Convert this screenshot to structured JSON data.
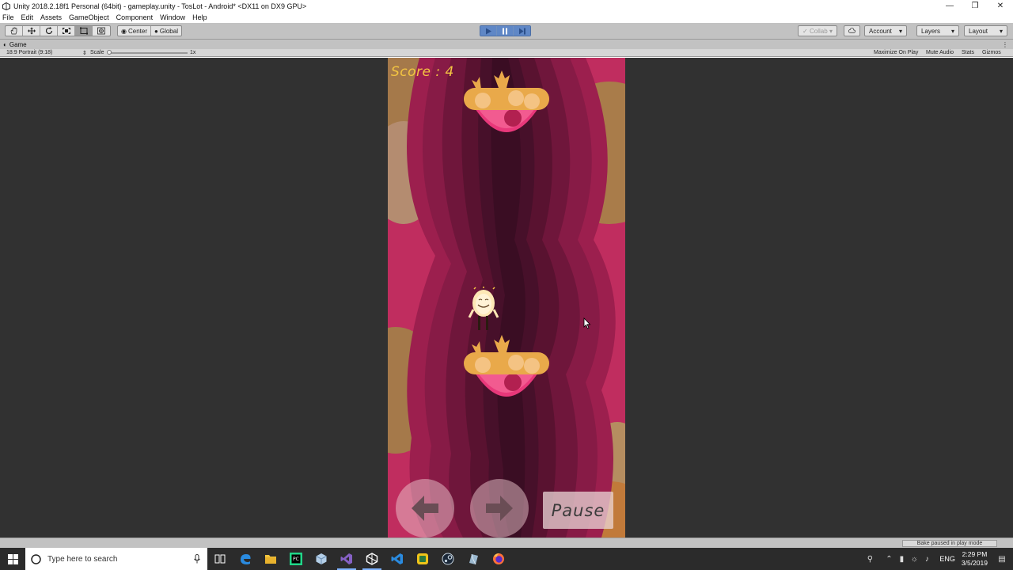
{
  "window": {
    "title": "Unity 2018.2.18f1 Personal (64bit) - gameplay.unity - TosLot - Android* <DX11 on DX9 GPU>",
    "controls": [
      "minimize-icon",
      "restore-icon",
      "close-icon"
    ]
  },
  "menu": [
    "File",
    "Edit",
    "Assets",
    "GameObject",
    "Component",
    "Window",
    "Help"
  ],
  "toolbar": {
    "tools": [
      "hand-icon",
      "move-icon",
      "rotate-icon",
      "scale-icon",
      "rect-icon",
      "transform-icon"
    ],
    "pivot_label": "Center",
    "space_label": "Global",
    "playback": [
      "play-icon",
      "pause-icon",
      "step-icon"
    ],
    "collab_label": "Collab",
    "account_label": "Account",
    "layers_label": "Layers",
    "layout_label": "Layout"
  },
  "game_tab": {
    "title": "Game",
    "aspect": "18:9 Portrait (9:18)",
    "scale_label": "Scale",
    "scale_value": "1x",
    "options": [
      "Maximize On Play",
      "Mute Audio",
      "Stats",
      "Gizmos"
    ]
  },
  "game": {
    "score_text": "Score : 4",
    "pause_label": "Pause",
    "left_arrow": "left-arrow-icon",
    "right_arrow": "right-arrow-icon",
    "colors": {
      "background": "#313131",
      "score": "#f4c542",
      "platform_top": "#e9a94a",
      "platform_bowl": "#e8387a"
    }
  },
  "status": {
    "bake": "Bake paused in play mode"
  },
  "taskbar": {
    "search_placeholder": "Type here to search",
    "apps": [
      "task-view-icon",
      "edge-icon",
      "explorer-icon",
      "pycharm-icon",
      "unity-cube-icon",
      "visual-studio-icon",
      "unity-icon",
      "vscode-icon",
      "app-icon",
      "steam-icon",
      "unity-hub-icon",
      "firefox-icon"
    ],
    "language": "ENG",
    "time": "2:29 PM",
    "date": "3/5/2019"
  }
}
